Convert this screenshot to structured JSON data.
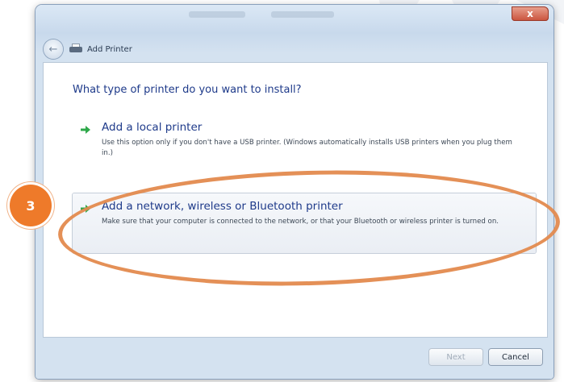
{
  "window": {
    "close_symbol": "x",
    "back_symbol": "←"
  },
  "nav": {
    "title": "Add Printer"
  },
  "heading": "What type of printer do you want to install?",
  "options": [
    {
      "title": "Add a local printer",
      "description": "Use this option only if you don't have a USB printer. (Windows automatically installs USB printers when you plug them in.)"
    },
    {
      "title": "Add a network, wireless or Bluetooth printer",
      "description": "Make sure that your computer is connected to the network, or that your Bluetooth or wireless printer is turned on."
    }
  ],
  "buttons": {
    "next": "Next",
    "cancel": "Cancel"
  },
  "annotation": {
    "step": "3"
  },
  "colors": {
    "accent": "#1e3a8a",
    "annotation": "#e38a4e",
    "badge": "#ee7a2a",
    "arrow": "#2ea84a"
  },
  "icons": [
    "back-arrow-icon",
    "printer-icon",
    "green-arrow-icon",
    "close-icon"
  ]
}
